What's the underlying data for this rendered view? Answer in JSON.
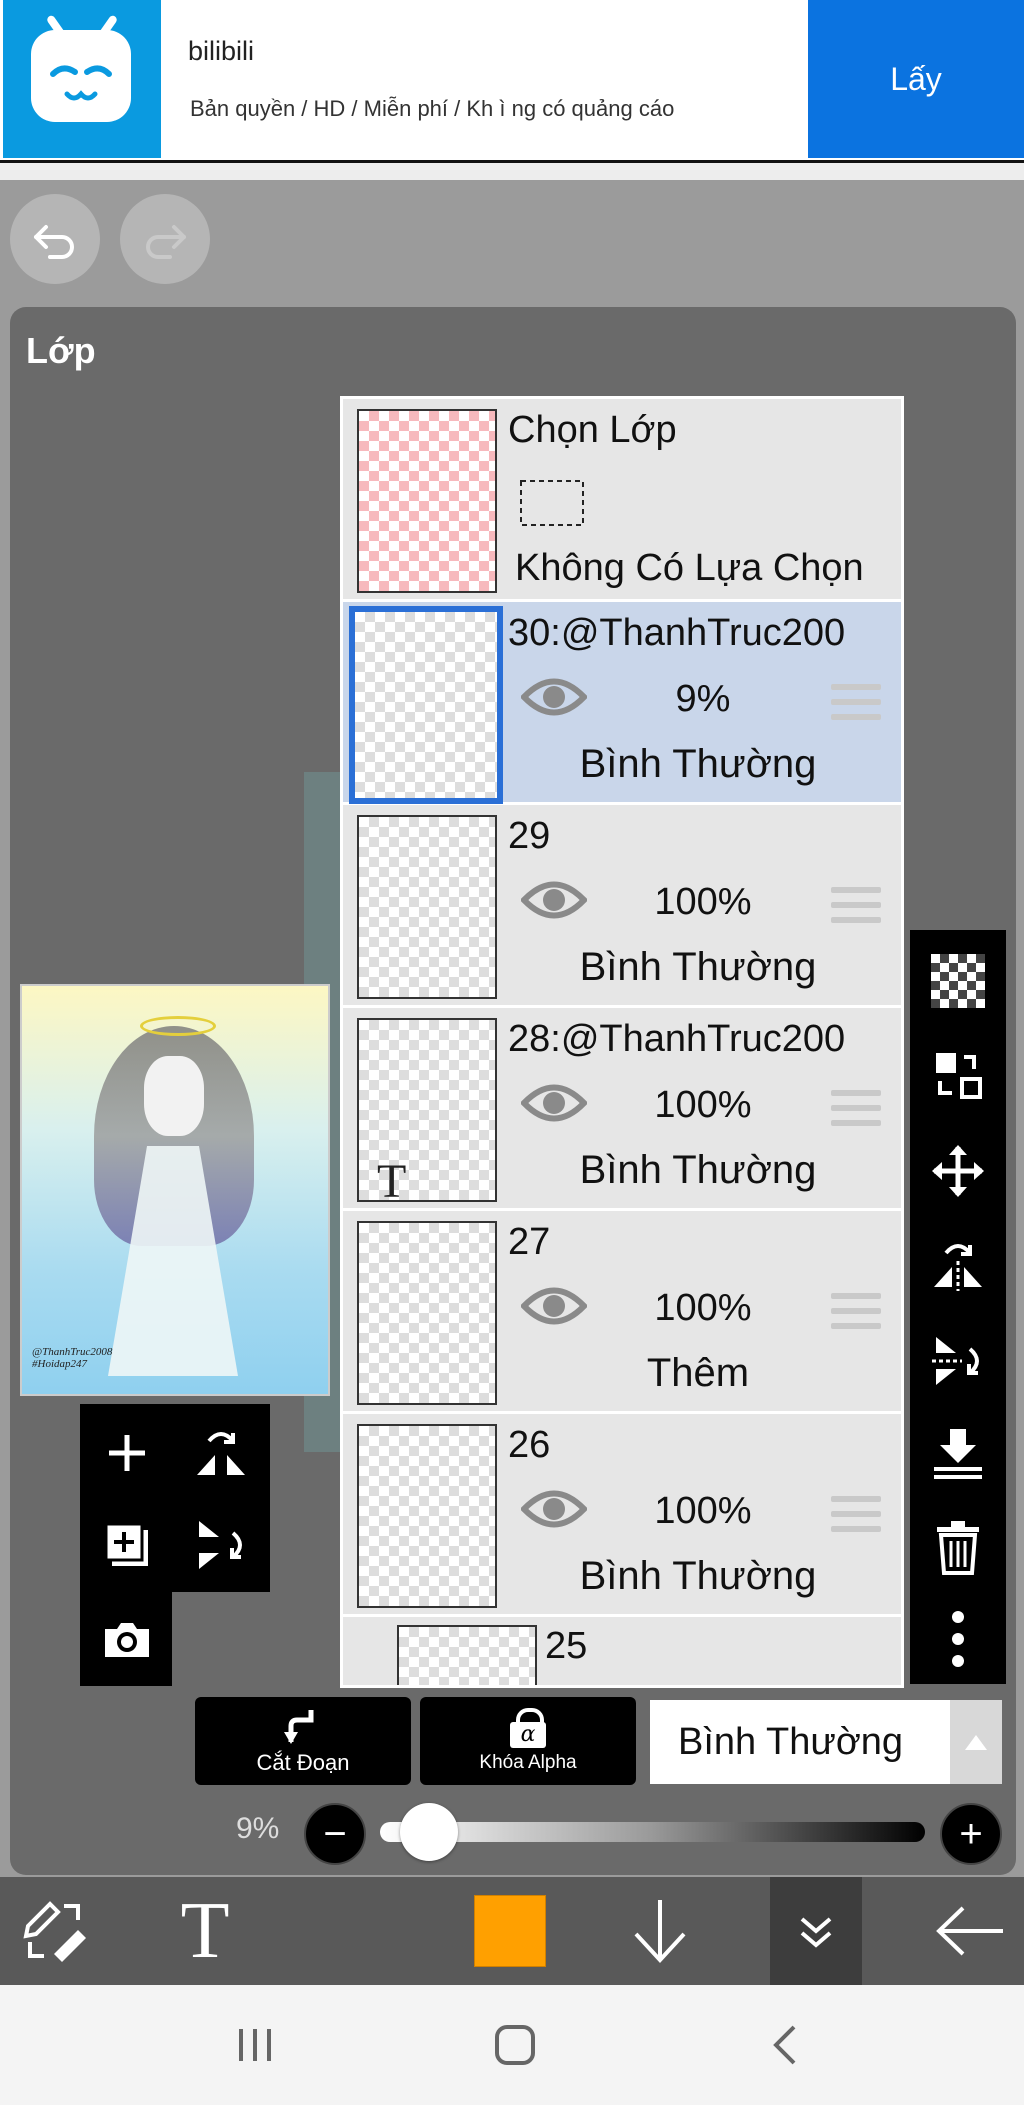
{
  "ad": {
    "title": "bilibili",
    "subtitle": "Bản quyền / HD / Miễn phí / Kh ì ng có quảng cáo",
    "cta": "Lấy"
  },
  "panel": {
    "title": "Lớp"
  },
  "selection_row": {
    "title": "Chọn Lớp",
    "status": "Không Có Lựa Chọn"
  },
  "layers": [
    {
      "name": "30:@ThanhTruc200",
      "opacity": "9%",
      "blend": "Bình Thường",
      "selected": true
    },
    {
      "name": "29",
      "opacity": "100%",
      "blend": "Bình Thường"
    },
    {
      "name": "28:@ThanhTruc200",
      "opacity": "100%",
      "blend": "Bình Thường",
      "text_layer": true
    },
    {
      "name": "27",
      "opacity": "100%",
      "blend": "Thêm"
    },
    {
      "name": "26",
      "opacity": "100%",
      "blend": "Bình Thường"
    },
    {
      "name": "25"
    }
  ],
  "preview": {
    "watermark1": "@ThanhTruc2008",
    "watermark2": "#Hoidap247"
  },
  "controls": {
    "clip_label": "Cắt Đoạn",
    "alpha_label": "Khóa Alpha",
    "alpha_glyph": "α",
    "blend_mode": "Bình Thường",
    "opacity_label": "9%",
    "opacity_value": 0.09,
    "minus": "−",
    "plus": "+"
  },
  "toolbar": {
    "text_glyph": "T",
    "color": "#FFA000"
  },
  "theme": {
    "ad_blue": "#0b73e0",
    "selected_row": "#c9d6ea",
    "selected_border": "#2a6fd6"
  }
}
